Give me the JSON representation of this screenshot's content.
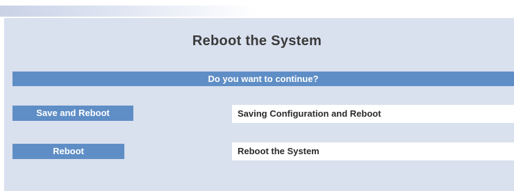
{
  "page": {
    "title": "Reboot the System"
  },
  "prompt": {
    "question": "Do you want to continue?"
  },
  "actions": [
    {
      "button_label": "Save and Reboot",
      "description": "Saving Configuration and Reboot"
    },
    {
      "button_label": "Reboot",
      "description": "Reboot the System"
    }
  ],
  "colors": {
    "panel_background": "#d9e0ee",
    "accent_blue": "#5f8ec6",
    "title_text": "#3a3a3a"
  }
}
